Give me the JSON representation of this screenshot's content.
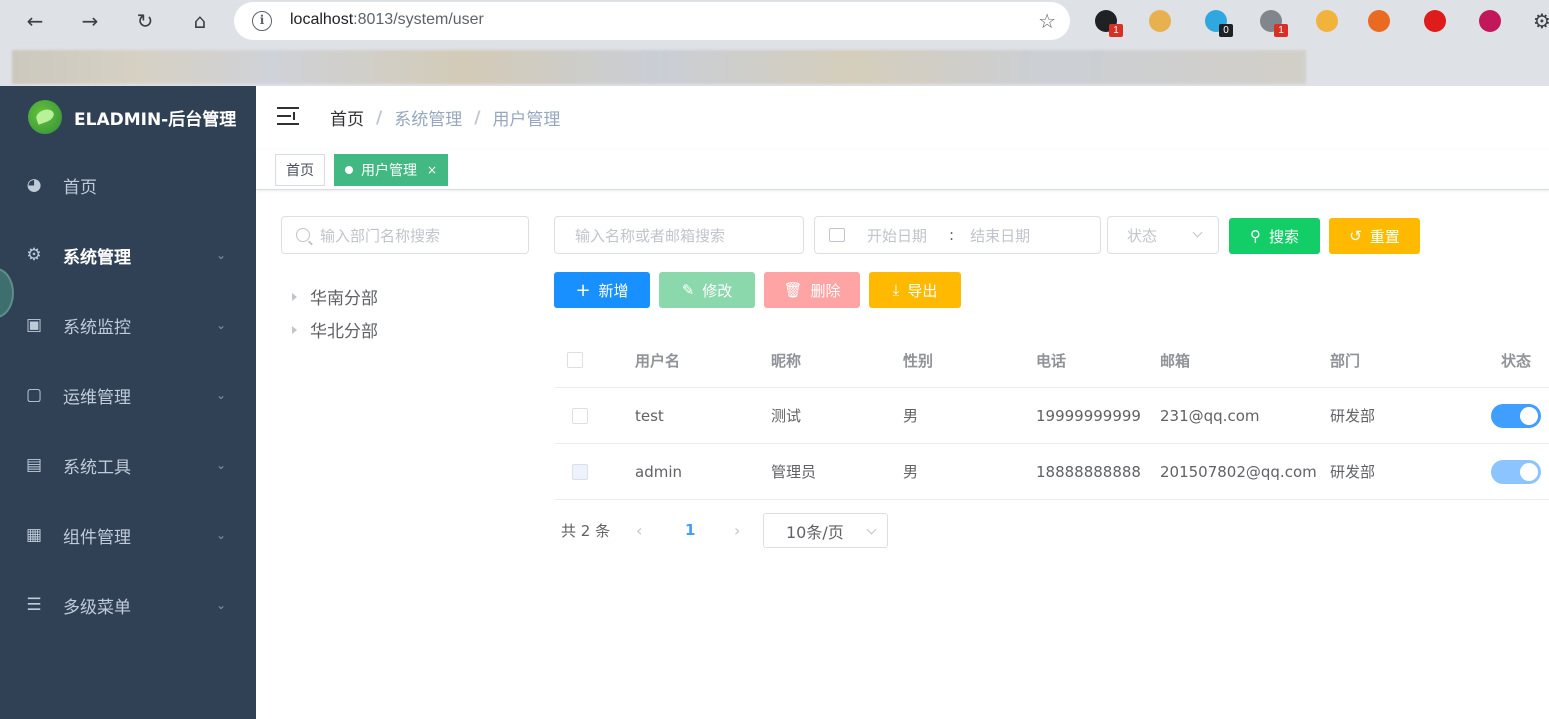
{
  "browser": {
    "url_host": "localhost",
    "url_port_path": ":8013/system/user",
    "extensions": [
      {
        "name": "ext-black",
        "color": "#202124",
        "badge": "1",
        "badge_color": "#d93025"
      },
      {
        "name": "ext-shield",
        "color": "#e8b14f",
        "badge": "",
        "badge_color": ""
      },
      {
        "name": "ext-ghost",
        "color": "#2fa8e0",
        "badge": "0",
        "badge_color": "#202124"
      },
      {
        "name": "ext-gray",
        "color": "#80868b",
        "badge": "1",
        "badge_color": "#d93025"
      },
      {
        "name": "ext-broom",
        "color": "#f2b33d",
        "badge": "",
        "badge_color": ""
      },
      {
        "name": "ext-s",
        "color": "#ea6a21",
        "badge": "",
        "badge_color": ""
      },
      {
        "name": "ext-adblock",
        "color": "#e01b1b",
        "badge": "",
        "badge_color": ""
      },
      {
        "name": "ext-du",
        "color": "#c2185b",
        "badge": "",
        "badge_color": ""
      }
    ]
  },
  "sidebar": {
    "logo_title": "ELADMIN-后台管理",
    "items": [
      {
        "label": "首页",
        "icon": "dashboard-icon",
        "expandable": false
      },
      {
        "label": "系统管理",
        "icon": "gear-icon",
        "expandable": true
      },
      {
        "label": "系统监控",
        "icon": "monitor-icon",
        "expandable": true
      },
      {
        "label": "运维管理",
        "icon": "ops-icon",
        "expandable": true
      },
      {
        "label": "系统工具",
        "icon": "tools-icon",
        "expandable": true
      },
      {
        "label": "组件管理",
        "icon": "grid-icon",
        "expandable": true
      },
      {
        "label": "多级菜单",
        "icon": "list-icon",
        "expandable": true
      }
    ]
  },
  "breadcrumb": [
    "首页",
    "系统管理",
    "用户管理"
  ],
  "tags": {
    "home": "首页",
    "active": "用户管理",
    "close": "×"
  },
  "dept_search": {
    "placeholder": "输入部门名称搜索"
  },
  "tree": [
    "华南分部",
    "华北分部"
  ],
  "filters": {
    "name_placeholder": "输入名称或者邮箱搜索",
    "start_date": "开始日期",
    "date_sep": ":",
    "end_date": "结束日期",
    "status_placeholder": "状态",
    "search_label": "搜索",
    "reset_label": "重置"
  },
  "actions": {
    "add": "新增",
    "edit": "修改",
    "delete": "删除",
    "export": "导出"
  },
  "colors": {
    "primary": "#409eff",
    "success": "#13ce66",
    "warning": "#ffba00",
    "danger": "#ff4949",
    "tag_active": "#42b983",
    "sidebar_bg": "#304156"
  },
  "table": {
    "headers": [
      "用户名",
      "昵称",
      "性别",
      "电话",
      "邮箱",
      "部门",
      "状态"
    ],
    "rows": [
      {
        "username": "test",
        "nickname": "测试",
        "gender": "男",
        "phone": "19999999999",
        "email": "231@qq.com",
        "dept": "研发部",
        "enabled": true,
        "disabled_row": false
      },
      {
        "username": "admin",
        "nickname": "管理员",
        "gender": "男",
        "phone": "18888888888",
        "email": "201507802@qq.com",
        "dept": "研发部",
        "enabled": true,
        "disabled_row": true
      }
    ]
  },
  "pagination": {
    "total_text": "共 2 条",
    "current_page": "1",
    "page_size": "10条/页"
  }
}
